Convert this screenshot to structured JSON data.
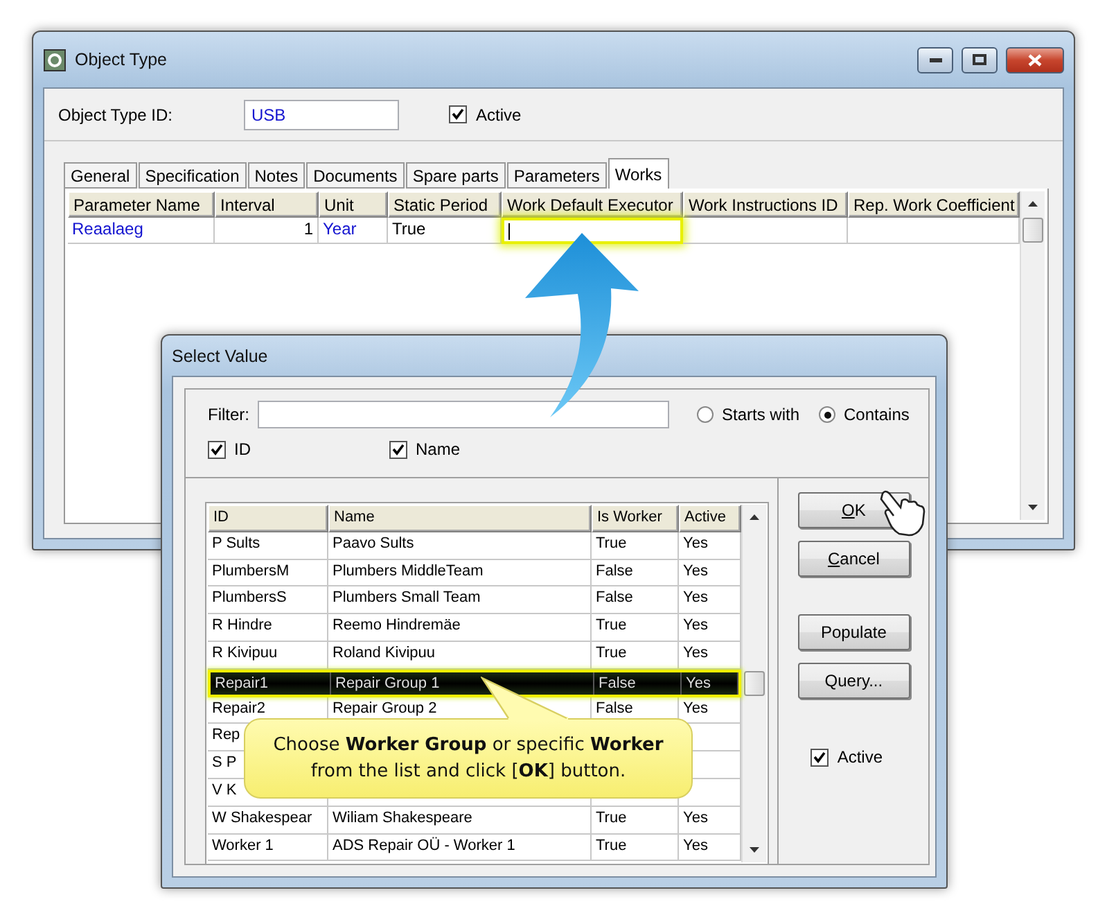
{
  "main_window": {
    "title": "Object Type",
    "id_label": "Object Type ID:",
    "id_value": "USB",
    "active": {
      "label": "Active",
      "checked": true
    },
    "tabs": [
      {
        "label": "General",
        "selected": false
      },
      {
        "label": "Specification",
        "selected": false
      },
      {
        "label": "Notes",
        "selected": false
      },
      {
        "label": "Documents",
        "selected": false
      },
      {
        "label": "Spare parts",
        "selected": false
      },
      {
        "label": "Parameters",
        "selected": false
      },
      {
        "label": "Works",
        "selected": true
      }
    ],
    "grid": {
      "columns": [
        "Parameter Name",
        "Interval",
        "Unit",
        "Static Period",
        "Work Default Executor",
        "Work Instructions ID",
        "Rep. Work Coefficient"
      ],
      "rows": [
        {
          "cells": [
            {
              "text": "Reaalaeg",
              "link": true,
              "numeric": false
            },
            {
              "text": "1",
              "link": false,
              "numeric": true
            },
            {
              "text": "Year",
              "link": true,
              "numeric": false
            },
            {
              "text": "True",
              "link": false,
              "numeric": false
            }
          ],
          "editing": true
        }
      ]
    }
  },
  "dialog": {
    "title": "Select Value",
    "filter_label": "Filter:",
    "match_modes": [
      {
        "label": "Starts with",
        "selected": false
      },
      {
        "label": "Contains",
        "selected": true
      }
    ],
    "search_fields": [
      {
        "label": "ID",
        "checked": true
      },
      {
        "label": "Name",
        "checked": true
      }
    ],
    "table": {
      "columns": [
        "ID",
        "Name",
        "Is Worker",
        "Active"
      ],
      "rows": [
        {
          "id": "P Sults",
          "name": "Paavo Sults",
          "is_worker": "True",
          "active": "Yes",
          "selected": false
        },
        {
          "id": "PlumbersM",
          "name": "Plumbers MiddleTeam",
          "is_worker": "False",
          "active": "Yes",
          "selected": false
        },
        {
          "id": "PlumbersS",
          "name": "Plumbers Small Team",
          "is_worker": "False",
          "active": "Yes",
          "selected": false
        },
        {
          "id": "R Hindre",
          "name": "Reemo Hindremäe",
          "is_worker": "True",
          "active": "Yes",
          "selected": false
        },
        {
          "id": "R Kivipuu",
          "name": "Roland Kivipuu",
          "is_worker": "True",
          "active": "Yes",
          "selected": false
        },
        {
          "id": "Repair1",
          "name": "Repair Group 1",
          "is_worker": "False",
          "active": "Yes",
          "selected": true
        },
        {
          "id": "Repair2",
          "name": "Repair Group 2",
          "is_worker": "False",
          "active": "Yes",
          "selected": false
        },
        {
          "id": "Rep",
          "selected": false
        },
        {
          "id": "S P",
          "selected": false
        },
        {
          "id": "V K",
          "selected": false
        },
        {
          "id": "W Shakespear",
          "name": "Wiliam Shakespeare",
          "is_worker": "True",
          "active": "Yes",
          "selected": false
        },
        {
          "id": "Worker 1",
          "name": "ADS Repair OÜ - Worker 1",
          "is_worker": "True",
          "active": "Yes",
          "selected": false
        }
      ]
    },
    "buttons": [
      {
        "label": "OK",
        "mnemonic": true
      },
      {
        "label": "Cancel",
        "mnemonic": true
      },
      {
        "label": "Populate",
        "mnemonic": false
      },
      {
        "label": "Query...",
        "mnemonic": false
      }
    ],
    "active": {
      "label": "Active",
      "checked": true
    }
  },
  "callout": {
    "text": "Choose **Worker Group** or specific **Worker** from the list and click [**OK**] button."
  }
}
